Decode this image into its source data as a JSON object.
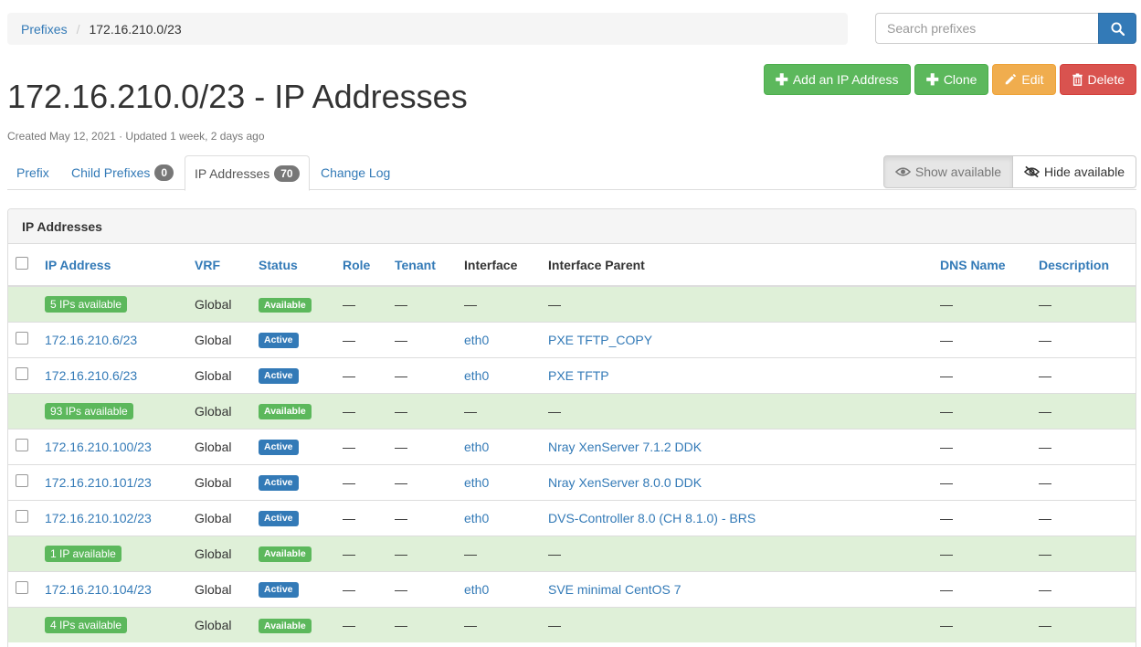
{
  "breadcrumb": {
    "parent": "Prefixes",
    "separator": "/",
    "current": "172.16.210.0/23"
  },
  "search": {
    "placeholder": "Search prefixes"
  },
  "actions": {
    "add_ip": "Add an IP Address",
    "clone": "Clone",
    "edit": "Edit",
    "delete": "Delete"
  },
  "page": {
    "title": "172.16.210.0/23 - IP Addresses",
    "meta": "Created May 12, 2021 · Updated 1 week, 2 days ago"
  },
  "tabs": [
    {
      "label": "Prefix"
    },
    {
      "label": "Child Prefixes",
      "badge": "0"
    },
    {
      "label": "IP Addresses",
      "badge": "70"
    },
    {
      "label": "Change Log"
    }
  ],
  "toggle": {
    "show": "Show available",
    "hide": "Hide available"
  },
  "panel": {
    "title": "IP Addresses"
  },
  "table": {
    "headers": [
      "IP Address",
      "VRF",
      "Status",
      "Role",
      "Tenant",
      "Interface",
      "Interface Parent",
      "DNS Name",
      "Description"
    ],
    "dash": "—",
    "rows": [
      {
        "available": true,
        "ip": "5 IPs available",
        "vrf": "Global",
        "status": "Available",
        "role": "—",
        "tenant": "—",
        "interface": "—",
        "parent": "—",
        "dns": "—",
        "desc": "—"
      },
      {
        "available": false,
        "ip": "172.16.210.6/23",
        "vrf": "Global",
        "status": "Active",
        "role": "—",
        "tenant": "—",
        "interface": "eth0",
        "parent": "PXE TFTP_COPY",
        "dns": "—",
        "desc": "—"
      },
      {
        "available": false,
        "ip": "172.16.210.6/23",
        "vrf": "Global",
        "status": "Active",
        "role": "—",
        "tenant": "—",
        "interface": "eth0",
        "parent": "PXE TFTP",
        "dns": "—",
        "desc": "—"
      },
      {
        "available": true,
        "ip": "93 IPs available",
        "vrf": "Global",
        "status": "Available",
        "role": "—",
        "tenant": "—",
        "interface": "—",
        "parent": "—",
        "dns": "—",
        "desc": "—"
      },
      {
        "available": false,
        "ip": "172.16.210.100/23",
        "vrf": "Global",
        "status": "Active",
        "role": "—",
        "tenant": "—",
        "interface": "eth0",
        "parent": "Nray XenServer 7.1.2 DDK",
        "dns": "—",
        "desc": "—"
      },
      {
        "available": false,
        "ip": "172.16.210.101/23",
        "vrf": "Global",
        "status": "Active",
        "role": "—",
        "tenant": "—",
        "interface": "eth0",
        "parent": "Nray XenServer 8.0.0 DDK",
        "dns": "—",
        "desc": "—"
      },
      {
        "available": false,
        "ip": "172.16.210.102/23",
        "vrf": "Global",
        "status": "Active",
        "role": "—",
        "tenant": "—",
        "interface": "eth0",
        "parent": "DVS-Controller 8.0 (CH 8.1.0) - BRS",
        "dns": "—",
        "desc": "—"
      },
      {
        "available": true,
        "ip": "1 IP available",
        "vrf": "Global",
        "status": "Available",
        "role": "—",
        "tenant": "—",
        "interface": "—",
        "parent": "—",
        "dns": "—",
        "desc": "—"
      },
      {
        "available": false,
        "ip": "172.16.210.104/23",
        "vrf": "Global",
        "status": "Active",
        "role": "—",
        "tenant": "—",
        "interface": "eth0",
        "parent": "SVE minimal CentOS 7",
        "dns": "—",
        "desc": "—"
      },
      {
        "available": true,
        "ip": "4 IPs available",
        "vrf": "Global",
        "status": "Available",
        "role": "—",
        "tenant": "—",
        "interface": "—",
        "parent": "—",
        "dns": "—",
        "desc": "—"
      }
    ]
  },
  "colors": {
    "primary": "#337ab7",
    "success": "#5cb85c",
    "warning": "#f0ad4e",
    "danger": "#d9534f",
    "available_row": "#dff0d8"
  },
  "icons": {
    "search": "search-icon",
    "add": "plus-icon",
    "clone": "plus-icon",
    "edit": "pencil-icon",
    "delete": "trash-icon",
    "show": "eye-icon",
    "hide": "eye-slash-icon"
  }
}
